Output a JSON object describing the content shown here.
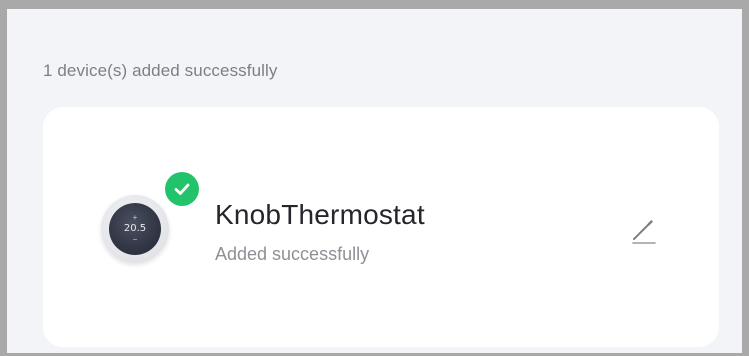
{
  "summary": {
    "text": "1 device(s) added successfully"
  },
  "device": {
    "name": "KnobThermostat",
    "status": "Added successfully",
    "display_temperature": "20.5",
    "icon": "thermostat-icon",
    "badge_icon": "check-icon",
    "edit_icon": "pencil-icon"
  },
  "colors": {
    "success_green": "#22c36a",
    "background": "#f3f4f7",
    "card": "#ffffff",
    "title_text": "#24262b",
    "muted_text": "#8e9096"
  }
}
